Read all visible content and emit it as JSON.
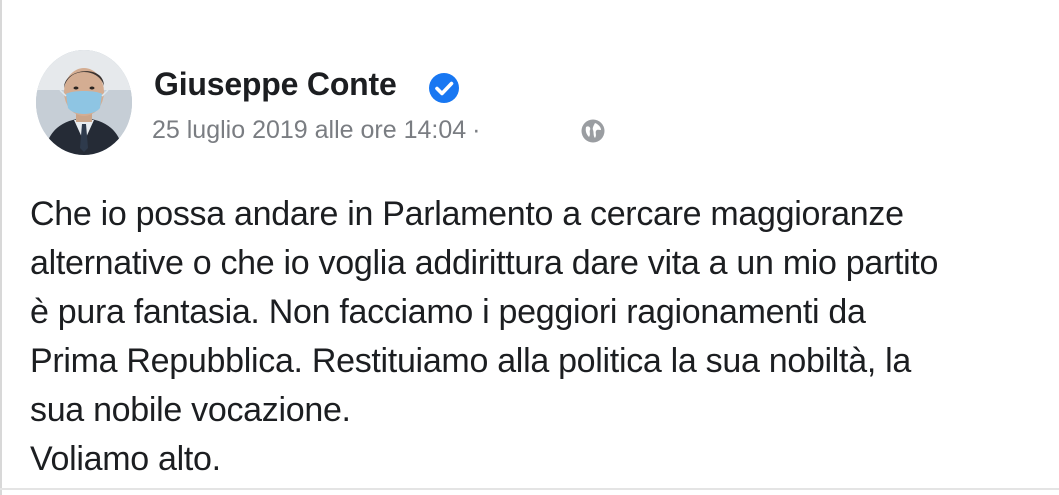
{
  "post": {
    "author": "Giuseppe Conte",
    "verified": true,
    "timestamp": "25 luglio 2019 alle ore 14:04",
    "separator": "·",
    "privacy_icon": "globe-icon",
    "text_lines": [
      "Che io possa andare in Parlamento a cercare maggioranze",
      "alternative o che io voglia addirittura dare vita a un mio partito",
      "è pura fantasia. Non facciamo i peggiori ragionamenti da",
      "Prima Repubblica. Restituiamo alla politica la sua nobiltà, la",
      "sua nobile vocazione.",
      "Voliamo alto."
    ]
  },
  "colors": {
    "text": "#1c1e21",
    "meta": "#7a7d82",
    "verified_badge": "#1877f2"
  }
}
